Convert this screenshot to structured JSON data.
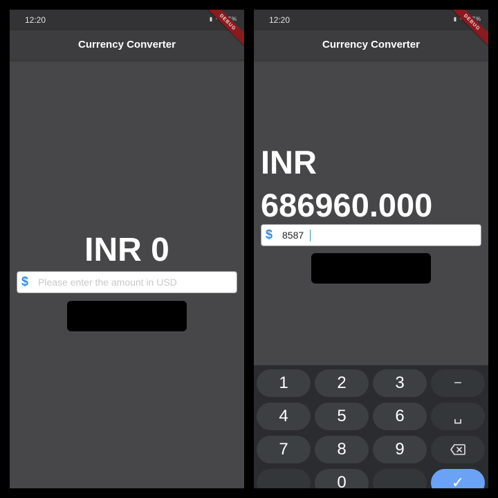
{
  "left_screen": {
    "status": {
      "time": "12:20",
      "icons_text": "▮ ⁴ᴳ 87%"
    },
    "app_bar": {
      "title": "Currency Converter"
    },
    "debug_banner": "DEBUG",
    "result_text": "INR 0",
    "amount_input": {
      "value": "",
      "placeholder": "Please enter the amount in USD"
    },
    "dollar_symbol": "$",
    "convert_button": {
      "label": "",
      "color": "#000000"
    }
  },
  "right_screen": {
    "status": {
      "time": "12:20",
      "icons_text": "▮ ⁴ᴳ 87%"
    },
    "app_bar": {
      "title": "Currency Converter"
    },
    "debug_banner": "DEBUG",
    "result_text": "INR 686960.000",
    "amount_input": {
      "value": "8587",
      "placeholder": "Please enter the amount in USD"
    },
    "dollar_symbol": "$",
    "convert_button": {
      "label": "",
      "color": "#000000"
    },
    "keyboard": {
      "keys": [
        {
          "label": "1",
          "name": "key-1"
        },
        {
          "label": "2",
          "name": "key-2"
        },
        {
          "label": "3",
          "name": "key-3"
        },
        {
          "label": "−",
          "name": "key-minus"
        },
        {
          "label": "4",
          "name": "key-4"
        },
        {
          "label": "5",
          "name": "key-5"
        },
        {
          "label": "6",
          "name": "key-6"
        },
        {
          "label": "␣",
          "name": "key-space"
        },
        {
          "label": "7",
          "name": "key-7"
        },
        {
          "label": "8",
          "name": "key-8"
        },
        {
          "label": "9",
          "name": "key-9"
        },
        {
          "label": "",
          "name": "key-backspace",
          "icon": "backspace-icon"
        },
        {
          "label": "",
          "name": "key-blank"
        },
        {
          "label": "0",
          "name": "key-0"
        },
        {
          "label": "",
          "name": "key-blank-2"
        },
        {
          "label": "✓",
          "name": "key-enter",
          "icon": "check-icon"
        }
      ]
    }
  },
  "colors": {
    "screen_background": "#474749",
    "app_bar": "#3d3d3f",
    "accent": "#2f8de4",
    "debug_banner": "#8b1a1f",
    "keyboard": "#2a2c2f",
    "enter_key": "#6aa2f5"
  }
}
